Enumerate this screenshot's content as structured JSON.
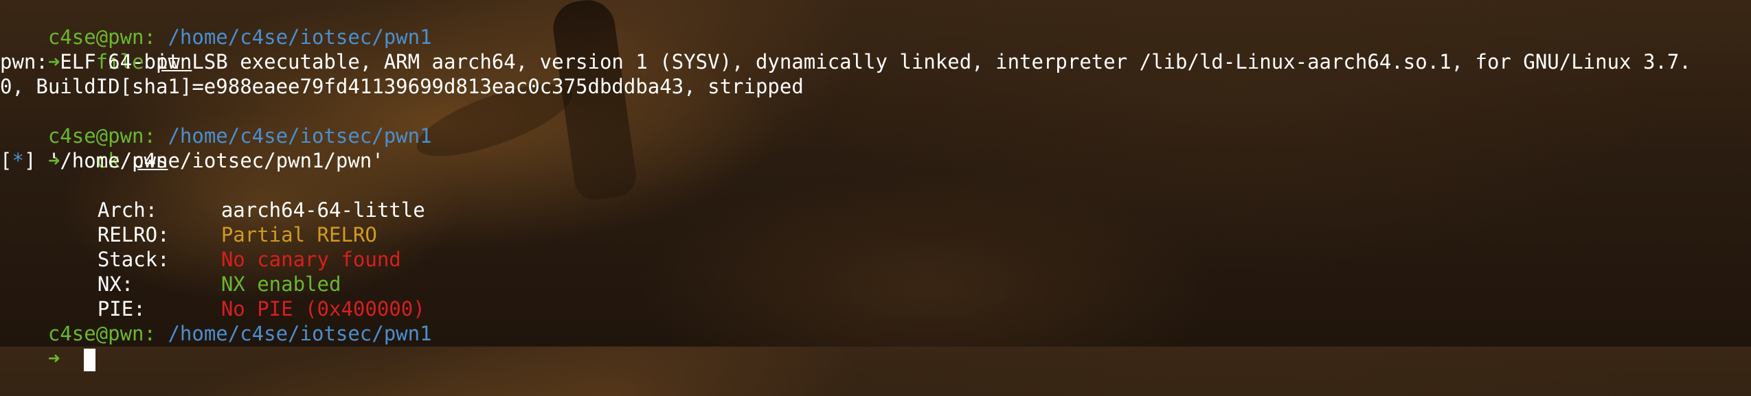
{
  "prompt": {
    "userhost": "c4se@pwn:",
    "path": "/home/c4se/iotsec/pwn1",
    "arrow": "➜"
  },
  "commands": [
    {
      "cmd": "file",
      "arg": "pwn"
    },
    {
      "cmd": "ck",
      "arg": "pwn"
    }
  ],
  "file_output": {
    "line1": "pwn: ELF 64-bit LSB executable, ARM aarch64, version 1 (SYSV), dynamically linked, interpreter /lib/ld-Linux-aarch64.so.1, for GNU/Linux 3.7.",
    "line2": "0, BuildID[sha1]=e988eaee79fd41139699d813eac0c375dbddba43, stripped"
  },
  "checksec": {
    "marker_open": "[",
    "marker_star": "*",
    "marker_close": "]",
    "target": " '/home/c4se/iotsec/pwn1/pwn'",
    "rows": [
      {
        "key": "Arch:",
        "value": "aarch64-64-little",
        "color": "#ffffff"
      },
      {
        "key": "RELRO:",
        "value": "Partial RELRO",
        "color": "#d19a1e"
      },
      {
        "key": "Stack:",
        "value": "No canary found",
        "color": "#d81f1f"
      },
      {
        "key": "NX:",
        "value": "NX enabled",
        "color": "#6ab82c"
      },
      {
        "key": "PIE:",
        "value": "No PIE (0x400000)",
        "color": "#d81f1f"
      }
    ]
  }
}
